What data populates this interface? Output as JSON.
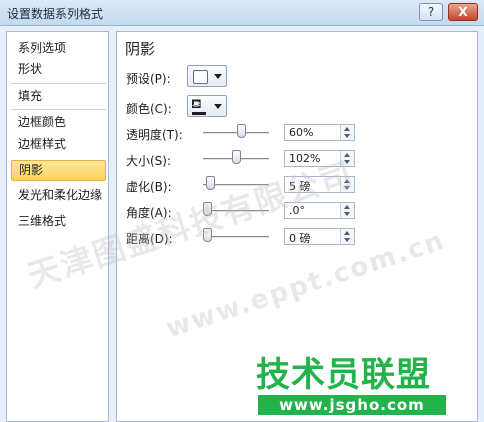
{
  "window": {
    "title": "设置数据系列格式",
    "help_label": "?",
    "close_label": "X"
  },
  "sidebar": {
    "items": [
      {
        "label": "系列选项"
      },
      {
        "label": "形状"
      },
      {
        "label": "填充"
      },
      {
        "label": "边框颜色"
      },
      {
        "label": "边框样式"
      },
      {
        "label": "阴影",
        "selected": true
      },
      {
        "label": "发光和柔化边缘"
      },
      {
        "label": "三维格式"
      }
    ]
  },
  "panel": {
    "heading": "阴影",
    "preset_label": "预设(P):",
    "color_label": "颜色(C):",
    "transparency": {
      "label": "透明度(T):",
      "value": "60%",
      "slider": 0.6
    },
    "size": {
      "label": "大小(S):",
      "value": "102%",
      "slider": 0.5
    },
    "blur": {
      "label": "虚化(B):",
      "value": "5 磅",
      "slider": 0.05
    },
    "angle": {
      "label": "角度(A):",
      "value": ".0°",
      "slider": 0.0
    },
    "distance": {
      "label": "距离(D):",
      "value": "0 磅",
      "slider": 0.0
    }
  },
  "watermark": {
    "line1": "天津图盛科技有限公司",
    "line2": "www.eppt.com.cn",
    "logo_main": "技术员联盟",
    "logo_url": "www.jsgho.com"
  },
  "colors": {
    "selected_bg": "#ffd25c",
    "logo_green": "#24b34a"
  }
}
